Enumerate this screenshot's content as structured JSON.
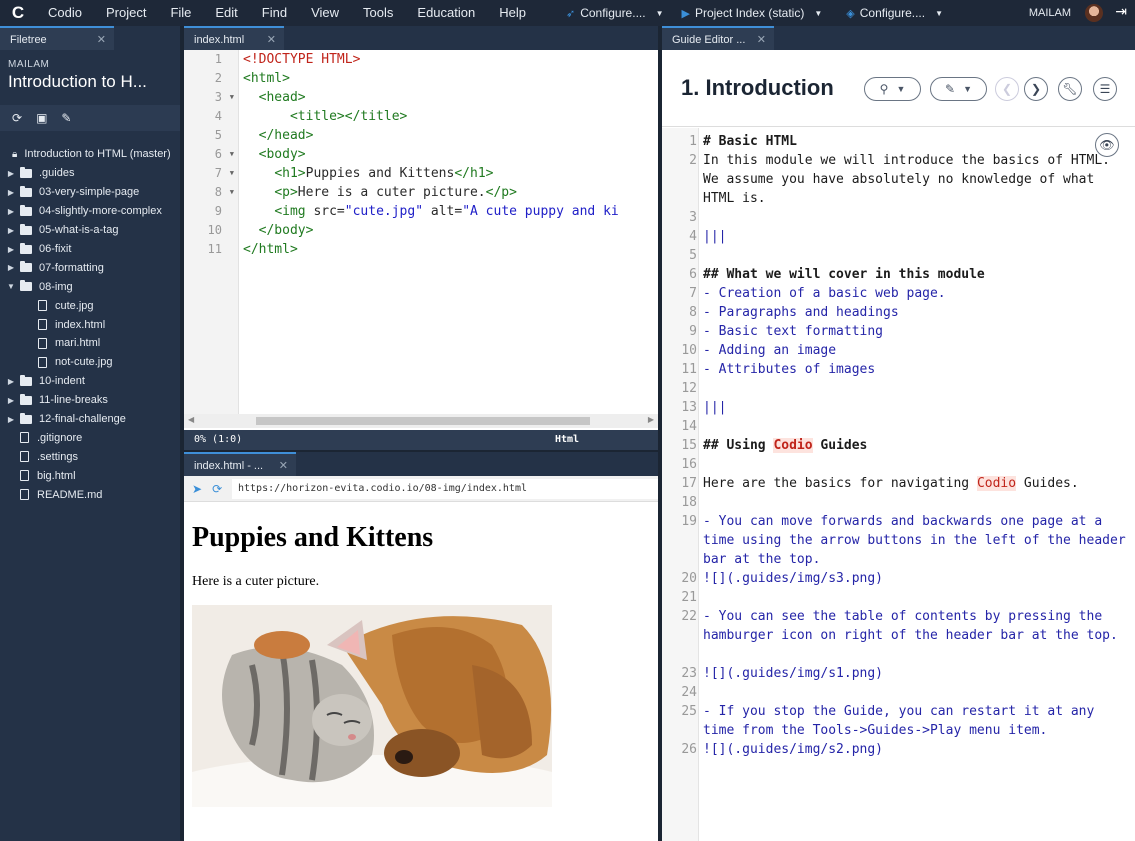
{
  "menubar": {
    "logo": "C",
    "items": [
      "Codio",
      "Project",
      "File",
      "Edit",
      "Find",
      "View",
      "Tools",
      "Education",
      "Help"
    ],
    "run_buttons": [
      {
        "icon": "rocket-icon",
        "label": "Configure...."
      },
      {
        "icon": "play-icon",
        "label": "Project Index (static)"
      },
      {
        "icon": "diamond-icon",
        "label": "Configure...."
      }
    ],
    "user": "MAILAM"
  },
  "filetree": {
    "tab_label": "Filetree",
    "owner": "MAILAM",
    "project_name": "Introduction to H...",
    "root": "Introduction to HTML (master)",
    "nodes": [
      {
        "type": "folder",
        "label": ".guides",
        "open": false,
        "indent": 0
      },
      {
        "type": "folder",
        "label": "03-very-simple-page",
        "open": false,
        "indent": 0
      },
      {
        "type": "folder",
        "label": "04-slightly-more-complex",
        "open": false,
        "indent": 0
      },
      {
        "type": "folder",
        "label": "05-what-is-a-tag",
        "open": false,
        "indent": 0
      },
      {
        "type": "folder",
        "label": "06-fixit",
        "open": false,
        "indent": 0
      },
      {
        "type": "folder",
        "label": "07-formatting",
        "open": false,
        "indent": 0
      },
      {
        "type": "folder",
        "label": "08-img",
        "open": true,
        "indent": 0
      },
      {
        "type": "file",
        "label": "cute.jpg",
        "indent": 1
      },
      {
        "type": "file",
        "label": "index.html",
        "indent": 1
      },
      {
        "type": "file",
        "label": "mari.html",
        "indent": 1
      },
      {
        "type": "file",
        "label": "not-cute.jpg",
        "indent": 1
      },
      {
        "type": "folder",
        "label": "10-indent",
        "open": false,
        "indent": 0
      },
      {
        "type": "folder",
        "label": "11-line-breaks",
        "open": false,
        "indent": 0
      },
      {
        "type": "folder",
        "label": "12-final-challenge",
        "open": false,
        "indent": 0
      },
      {
        "type": "file",
        "label": ".gitignore",
        "indent": 0
      },
      {
        "type": "file",
        "label": ".settings",
        "indent": 0
      },
      {
        "type": "file",
        "label": "big.html",
        "indent": 0
      },
      {
        "type": "file",
        "label": "README.md",
        "indent": 0
      }
    ]
  },
  "editor": {
    "tab_label": "index.html",
    "line_numbers": [
      "1",
      "2",
      "3",
      "4",
      "5",
      "6",
      "7",
      "8",
      "9",
      "10",
      "11"
    ],
    "fold_marks": [
      false,
      false,
      true,
      false,
      false,
      true,
      true,
      true,
      false,
      false,
      false
    ],
    "lines": [
      [
        {
          "c": "dt",
          "t": "<!DOCTYPE HTML>"
        }
      ],
      [
        {
          "c": "tg",
          "t": "<html>"
        }
      ],
      [
        {
          "c": "",
          "t": "  "
        },
        {
          "c": "tg",
          "t": "<head>"
        }
      ],
      [
        {
          "c": "",
          "t": "      "
        },
        {
          "c": "tg",
          "t": "<title></title>"
        }
      ],
      [
        {
          "c": "",
          "t": "  "
        },
        {
          "c": "tg",
          "t": "</head>"
        }
      ],
      [
        {
          "c": "",
          "t": "  "
        },
        {
          "c": "tg",
          "t": "<body>"
        }
      ],
      [
        {
          "c": "",
          "t": "    "
        },
        {
          "c": "tg",
          "t": "<h1>"
        },
        {
          "c": "at",
          "t": "Puppies and Kittens"
        },
        {
          "c": "tg",
          "t": "</h1>"
        }
      ],
      [
        {
          "c": "",
          "t": "    "
        },
        {
          "c": "tg",
          "t": "<p>"
        },
        {
          "c": "at",
          "t": "Here is a cuter picture."
        },
        {
          "c": "tg",
          "t": "</p>"
        }
      ],
      [
        {
          "c": "",
          "t": "    "
        },
        {
          "c": "tg",
          "t": "<img "
        },
        {
          "c": "at",
          "t": "src="
        },
        {
          "c": "sv",
          "t": "\"cute.jpg\""
        },
        {
          "c": "at",
          "t": " alt="
        },
        {
          "c": "sv",
          "t": "\"A cute puppy and ki"
        }
      ],
      [
        {
          "c": "",
          "t": "  "
        },
        {
          "c": "tg",
          "t": "</body>"
        }
      ],
      [
        {
          "c": "tg",
          "t": "</html>"
        }
      ]
    ],
    "status_left": "0% (1:0)",
    "status_mode": "Html"
  },
  "preview": {
    "tab_label": "index.html - ...",
    "url": "https://horizon-evita.codio.io/08-img/index.html",
    "heading": "Puppies and Kittens",
    "paragraph": "Here is a cuter picture."
  },
  "guide": {
    "tab_label": "Guide Editor ...",
    "title": "1. Introduction",
    "lines": [
      {
        "n": "1",
        "t": "# Basic HTML",
        "s": "b"
      },
      {
        "n": "2",
        "t": "In this module we will introduce the basics of HTML. We assume you have absolutely no knowledge of what HTML is.",
        "s": ""
      },
      {
        "n": "3",
        "t": "",
        "s": ""
      },
      {
        "n": "4",
        "t": "|||",
        "s": "li"
      },
      {
        "n": "5",
        "t": "",
        "s": ""
      },
      {
        "n": "6",
        "t": "## What we will cover in this module",
        "s": "b"
      },
      {
        "n": "7",
        "t": "- Creation of a basic web page.",
        "s": "li"
      },
      {
        "n": "8",
        "t": "- Paragraphs and headings",
        "s": "li"
      },
      {
        "n": "9",
        "t": "- Basic text formatting",
        "s": "li"
      },
      {
        "n": "10",
        "t": "- Adding an image",
        "s": "li"
      },
      {
        "n": "11",
        "t": "- Attributes of images",
        "s": "li"
      },
      {
        "n": "12",
        "t": "",
        "s": ""
      },
      {
        "n": "13",
        "t": "|||",
        "s": "li"
      },
      {
        "n": "14",
        "t": "",
        "s": ""
      },
      {
        "n": "15",
        "t": "## Using |Codio| Guides",
        "s": "b"
      },
      {
        "n": "16",
        "t": "",
        "s": ""
      },
      {
        "n": "17",
        "t": "Here are the basics for navigating |Codio| Guides.",
        "s": ""
      },
      {
        "n": "18",
        "t": "",
        "s": ""
      },
      {
        "n": "19",
        "t": "- You can move forwards and backwards one page at a time using the arrow buttons in the left of the header bar at the top.",
        "s": "li"
      },
      {
        "n": "20",
        "t": "![](.guides/img/s3.png)",
        "s": "li"
      },
      {
        "n": "21",
        "t": "",
        "s": ""
      },
      {
        "n": "22",
        "t": "- You can see the table of contents by pressing the  hamburger icon on right of the header bar at the top.",
        "s": "li"
      },
      {
        "n": "23",
        "t": "![](.guides/img/s1.png)",
        "s": "li"
      },
      {
        "n": "24",
        "t": "",
        "s": ""
      },
      {
        "n": "25",
        "t": "- If you stop the Guide, you can restart it at any time from the Tools->Guides->Play menu item.",
        "s": "li"
      },
      {
        "n": "26",
        "t": "![](.guides/img/s2.png)",
        "s": "li"
      }
    ]
  }
}
